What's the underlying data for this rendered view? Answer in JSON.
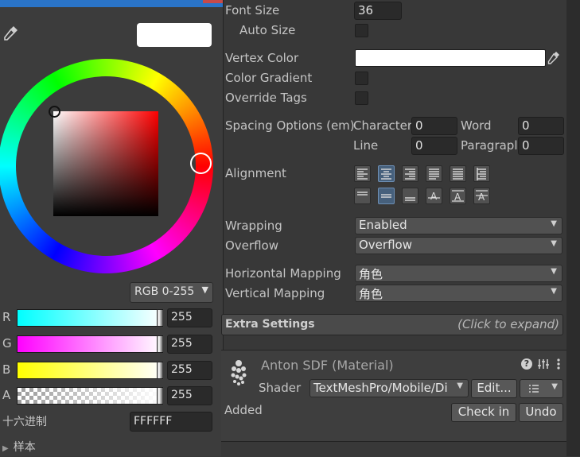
{
  "color_picker": {
    "color_mode": "RGB 0-255",
    "channels": [
      {
        "label": "R",
        "value": "255"
      },
      {
        "label": "G",
        "value": "255"
      },
      {
        "label": "B",
        "value": "255"
      },
      {
        "label": "A",
        "value": "255"
      }
    ],
    "hex_label": "十六进制",
    "hex_value": "FFFFFF",
    "presets_label": "样本",
    "current_color": "#ffffff"
  },
  "inspector": {
    "font_size": {
      "label": "Font Size",
      "value": "36"
    },
    "auto_size": {
      "label": "Auto Size"
    },
    "vertex_color": {
      "label": "Vertex Color",
      "value": "#ffffff"
    },
    "color_gradient": {
      "label": "Color Gradient"
    },
    "override_tags": {
      "label": "Override Tags"
    },
    "spacing": {
      "label": "Spacing Options (em)",
      "character_label": "Character",
      "character_value": "0",
      "word_label": "Word",
      "word_value": "0",
      "line_label": "Line",
      "line_value": "0",
      "paragraph_label": "Paragrapl",
      "paragraph_value": "0"
    },
    "alignment": {
      "label": "Alignment"
    },
    "wrapping": {
      "label": "Wrapping",
      "value": "Enabled"
    },
    "overflow": {
      "label": "Overflow",
      "value": "Overflow"
    },
    "horizontal_mapping": {
      "label": "Horizontal Mapping",
      "value": "角色"
    },
    "vertical_mapping": {
      "label": "Vertical Mapping",
      "value": "角色"
    },
    "extra_settings": {
      "title": "Extra Settings",
      "hint": "(Click to expand)"
    },
    "material": {
      "name": "Anton SDF (Material)",
      "shader_label": "Shader",
      "shader_value": "TextMeshPro/Mobile/Di",
      "edit_label": "Edit...",
      "added_label": "Added",
      "check_in_label": "Check in",
      "undo_label": "Undo"
    }
  }
}
